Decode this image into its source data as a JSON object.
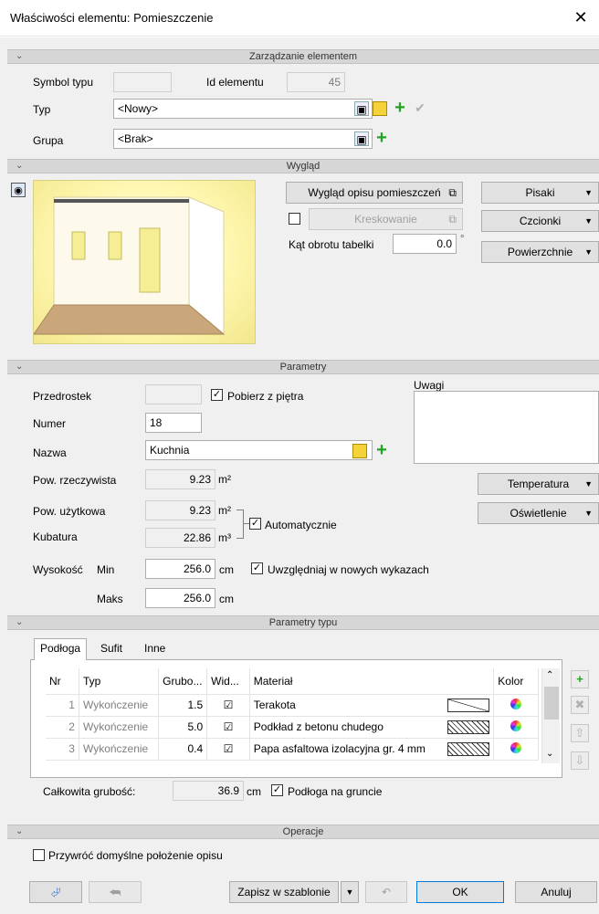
{
  "window": {
    "title": "Właściwości elementu: Pomieszczenie",
    "close": "✕"
  },
  "sections": {
    "management": "Zarządzanie elementem",
    "appearance": "Wygląd",
    "parameters": "Parametry",
    "type_parameters": "Parametry typu",
    "operations": "Operacje"
  },
  "management": {
    "symbol_label": "Symbol typu",
    "symbol_value": "",
    "id_label": "Id elementu",
    "id_value": "45",
    "type_label": "Typ",
    "type_value": "<Nowy>",
    "group_label": "Grupa",
    "group_value": "<Brak>"
  },
  "appearance": {
    "desc_button": "Wygląd opisu pomieszczeń",
    "hatch_button": "Kreskowanie",
    "angle_label": "Kąt obrotu tabelki",
    "angle_value": "0.0",
    "angle_unit": "°",
    "pens_button": "Pisaki",
    "fonts_button": "Czcionki",
    "surfaces_button": "Powierzchnie"
  },
  "parameters": {
    "prefix_label": "Przedrostek",
    "prefix_value": "",
    "from_floor_label": "Pobierz z piętra",
    "from_floor_checked": true,
    "number_label": "Numer",
    "number_value": "18",
    "name_label": "Nazwa",
    "name_value": "Kuchnia",
    "notes_label": "Uwagi",
    "notes_value": "",
    "real_area_label": "Pow. rzeczywista",
    "real_area_value": "9.23",
    "usable_area_label": "Pow. użytkowa",
    "usable_area_value": "9.23",
    "area_unit": "m²",
    "volume_label": "Kubatura",
    "volume_value": "22.86",
    "volume_unit": "m³",
    "auto_label": "Automatycznie",
    "auto_checked": true,
    "height_label": "Wysokość",
    "min_label": "Min",
    "min_value": "256.0",
    "max_label": "Maks",
    "max_value": "256.0",
    "cm_unit": "cm",
    "include_label": "Uwzględniaj w nowych wykazach",
    "include_checked": true,
    "temperature_button": "Temperatura",
    "lighting_button": "Oświetlenie"
  },
  "type_params": {
    "tabs": [
      "Podłoga",
      "Sufit",
      "Inne"
    ],
    "columns": [
      "Nr",
      "Typ",
      "Grubo...",
      "Wid...",
      "Materiał",
      "Kolor"
    ],
    "rows": [
      {
        "nr": "1",
        "typ": "Wykończenie",
        "grubosc": "1.5",
        "widoczny": true,
        "material": "Terakota"
      },
      {
        "nr": "2",
        "typ": "Wykończenie",
        "grubosc": "5.0",
        "widoczny": true,
        "material": "Podkład z betonu chudego"
      },
      {
        "nr": "3",
        "typ": "Wykończenie",
        "grubosc": "0.4",
        "widoczny": true,
        "material": "Papa asfaltowa izolacyjna gr. 4 mm"
      }
    ],
    "total_label": "Całkowita grubość:",
    "total_value": "36.9",
    "total_unit": "cm",
    "ground_label": "Podłoga na gruncie",
    "ground_checked": true
  },
  "operations": {
    "restore_label": "Przywróć domyślne położenie opisu",
    "restore_checked": false
  },
  "footer": {
    "save_template": "Zapisz w szablonie",
    "ok": "OK",
    "cancel": "Anuluj"
  }
}
